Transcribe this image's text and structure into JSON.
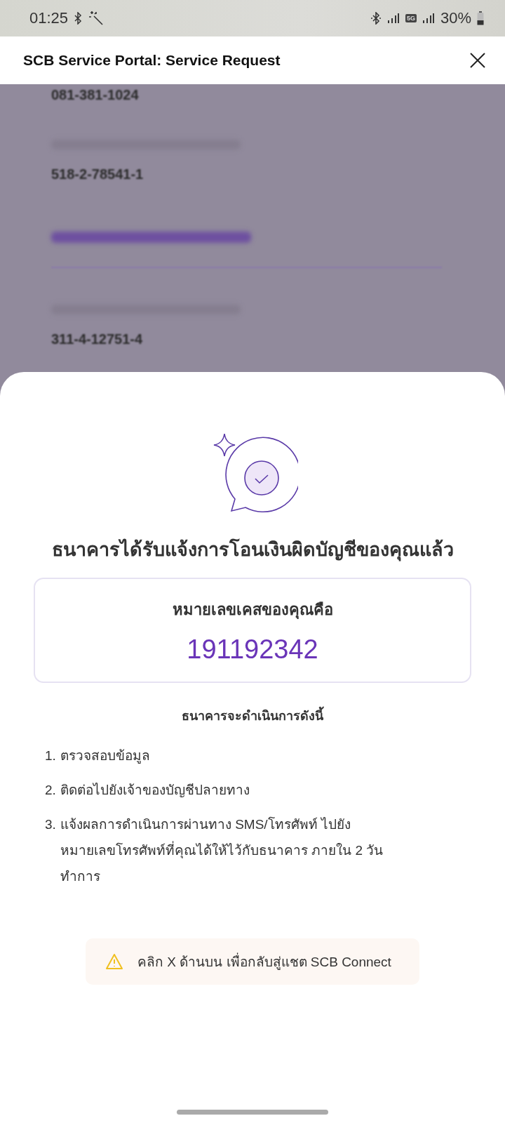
{
  "status_bar": {
    "time": "01:25",
    "network": "5G",
    "battery": "30%"
  },
  "header": {
    "title": "SCB Service Portal: Service Request"
  },
  "background": {
    "values": [
      "081-381-1024",
      "518-2-78541-1",
      "311-4-12751-4"
    ]
  },
  "sheet": {
    "heading": "ธนาคารได้รับแจ้งการโอนเงินผิดบัญชีของคุณแล้ว",
    "case_label": "หมายเลขเคสของคุณคือ",
    "case_number": "191192342",
    "steps_title": "ธนาคารจะดำเนินการดังนี้",
    "steps": [
      {
        "number": "1.",
        "text": "ตรวจสอบข้อมูล"
      },
      {
        "number": "2.",
        "text": "ติดต่อไปยังเจ้าของบัญชีปลายทาง"
      },
      {
        "number": "3.",
        "text": "แจ้งผลการดำเนินการผ่านทาง SMS/โทรศัพท์ ไปยังหมายเลขโทรศัพท์ที่คุณได้ให้ไว้กับธนาคาร ภายใน 2 วันทำการ"
      }
    ],
    "notice": "คลิก X ด้านบน เพื่อกลับสู่แชต SCB Connect"
  }
}
